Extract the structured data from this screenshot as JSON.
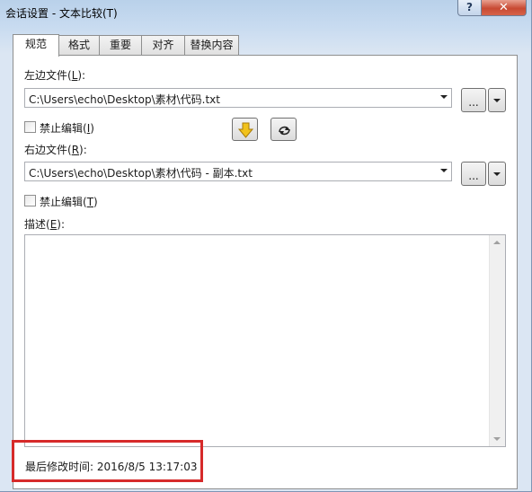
{
  "window": {
    "title": "会话设置 - 文本比较(T)",
    "help_glyph": "?",
    "close_glyph": "✕"
  },
  "tabs": [
    {
      "label": "规范",
      "active": true
    },
    {
      "label": "格式",
      "active": false
    },
    {
      "label": "重要",
      "active": false
    },
    {
      "label": "对齐",
      "active": false
    },
    {
      "label": "替换内容",
      "active": false
    }
  ],
  "left_file": {
    "label_prefix": "左边文件(",
    "label_key": "L",
    "label_suffix": "):",
    "value": "C:\\Users\\echo\\Desktop\\素材\\代码.txt",
    "browse_label": "...",
    "readonly_prefix": "禁止编辑(",
    "readonly_key": "I",
    "readonly_suffix": ")",
    "readonly_checked": false
  },
  "right_file": {
    "label_prefix": "右边文件(",
    "label_key": "R",
    "label_suffix": "):",
    "value": "C:\\Users\\echo\\Desktop\\素材\\代码 - 副本.txt",
    "browse_label": "...",
    "readonly_prefix": "禁止编辑(",
    "readonly_key": "T",
    "readonly_suffix": ")",
    "readonly_checked": false
  },
  "swap_buttons": {
    "copy_down_icon": "arrow-down-icon",
    "swap_icon": "swap-icon"
  },
  "description": {
    "label_prefix": "描述(",
    "label_key": "E",
    "label_suffix": "):",
    "value": ""
  },
  "footer": {
    "last_modified_label": "最后修改时间:",
    "last_modified_value": "2016/8/5 13:17:03"
  },
  "colors": {
    "highlight": "#d62a2a",
    "arrow_fill": "#f1c21b"
  }
}
